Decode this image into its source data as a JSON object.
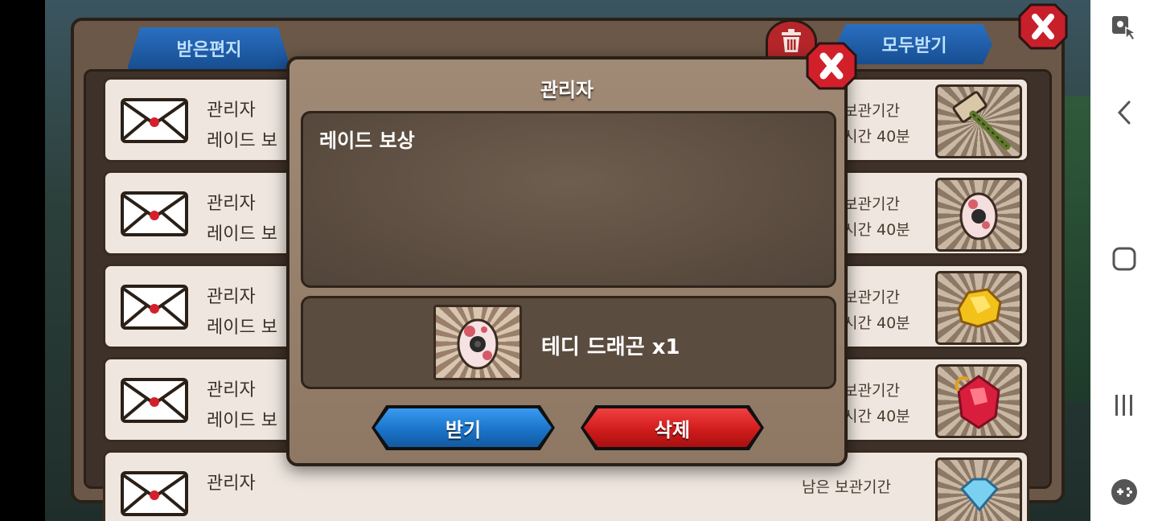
{
  "mailbox": {
    "tab_inbox": "받은편지",
    "tab_receive_all": "모두받기",
    "rows": [
      {
        "sender": "관리자",
        "subject": "레이드 보",
        "expiry_label": "보관기간",
        "expiry_time": "시간 40분",
        "reward_icon": "hammer-icon"
      },
      {
        "sender": "관리자",
        "subject": "레이드 보",
        "expiry_label": "보관기간",
        "expiry_time": "시간 40분",
        "reward_icon": "egg-icon"
      },
      {
        "sender": "관리자",
        "subject": "레이드 보",
        "expiry_label": "보관기간",
        "expiry_time": "시간 40분",
        "reward_icon": "gold-ore-icon"
      },
      {
        "sender": "관리자",
        "subject": "레이드 보",
        "expiry_label": "보관기간",
        "expiry_time": "시간 40분",
        "reward_icon": "ruby-gem-icon"
      },
      {
        "sender": "관리자",
        "subject": "",
        "expiry_label": "남은 보관기간",
        "expiry_time": "",
        "reward_icon": "diamond-icon"
      }
    ]
  },
  "modal": {
    "title": "관리자",
    "message": "레이드 보상",
    "reward_text": "테디 드래곤 x1",
    "reward_icon": "teddy-dragon-egg-icon",
    "receive_label": "받기",
    "delete_label": "삭제"
  },
  "colors": {
    "blue_button": "#1a74c9",
    "red_button": "#d11c1c",
    "panel_brown": "#6b5848",
    "modal_brown": "#a08a76"
  }
}
